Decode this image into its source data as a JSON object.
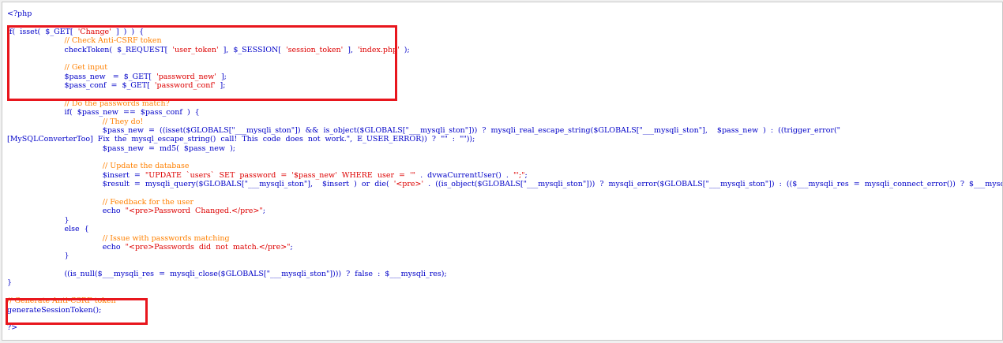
{
  "colors": {
    "keyword": "#0000C8",
    "comment": "#FF8000",
    "string": "#DD0000",
    "highlight": "#E8161D",
    "background": "#FFFFFF"
  },
  "code": {
    "lines": [
      {
        "segments": [
          {
            "text": "<?php",
            "style": "blue"
          }
        ]
      },
      {
        "segments": [
          {
            "text": "",
            "style": "blue"
          }
        ]
      },
      {
        "segments": [
          {
            "text": "if(  isset(  $_GET[  ",
            "style": "blue"
          },
          {
            "text": "'Change'",
            "style": "red"
          },
          {
            "text": "  ]  )  )  {",
            "style": "blue"
          }
        ]
      },
      {
        "segments": [
          {
            "text": "                        // Check Anti-CSRF token",
            "style": "orange"
          }
        ]
      },
      {
        "segments": [
          {
            "text": "                        checkToken(  $_REQUEST[  ",
            "style": "blue"
          },
          {
            "text": "'user_token'",
            "style": "red"
          },
          {
            "text": "  ],  $_SESSION[  ",
            "style": "blue"
          },
          {
            "text": "'session_token'",
            "style": "red"
          },
          {
            "text": "  ],  ",
            "style": "blue"
          },
          {
            "text": "'index.php'",
            "style": "red"
          },
          {
            "text": "  );",
            "style": "blue"
          }
        ]
      },
      {
        "segments": [
          {
            "text": "",
            "style": "blue"
          }
        ]
      },
      {
        "segments": [
          {
            "text": "                        // Get input",
            "style": "orange"
          }
        ]
      },
      {
        "segments": [
          {
            "text": "                        $pass_new   =  $_GET[  ",
            "style": "blue"
          },
          {
            "text": "'password_new'",
            "style": "red"
          },
          {
            "text": "  ];",
            "style": "blue"
          }
        ]
      },
      {
        "segments": [
          {
            "text": "                        $pass_conf  =  $_GET[  ",
            "style": "blue"
          },
          {
            "text": "'password_conf'",
            "style": "red"
          },
          {
            "text": "  ];",
            "style": "blue"
          }
        ]
      },
      {
        "segments": [
          {
            "text": "",
            "style": "blue"
          }
        ]
      },
      {
        "segments": [
          {
            "text": "                        // Do the passwords match?",
            "style": "orange"
          }
        ]
      },
      {
        "segments": [
          {
            "text": "                        if(  $pass_new  ==  $pass_conf  )  {",
            "style": "blue"
          }
        ]
      },
      {
        "segments": [
          {
            "text": "                                        // They do!",
            "style": "orange"
          }
        ]
      },
      {
        "segments": [
          {
            "text": "                                        $pass_new  =  ((isset($GLOBALS[\"___mysqli_ston\"])  &&  is_object($GLOBALS[\"___mysqli_ston\"]))  ?  mysqli_real_escape_string($GLOBALS[\"___mysqli_ston\"],    $pass_new  )  :  ((trigger_error(\"",
            "style": "blue"
          }
        ]
      },
      {
        "segments": [
          {
            "text": "[MySQLConverterToo]  Fix  the  mysql_escape_string()  call!  This  code  does  not  work.\",  E_USER_ERROR))  ?  \"\"  :  \"\"));",
            "style": "blue"
          }
        ]
      },
      {
        "segments": [
          {
            "text": "                                        $pass_new  =  md5(  $pass_new  );",
            "style": "blue"
          }
        ]
      },
      {
        "segments": [
          {
            "text": "",
            "style": "blue"
          }
        ]
      },
      {
        "segments": [
          {
            "text": "                                        // Update the database",
            "style": "orange"
          }
        ]
      },
      {
        "segments": [
          {
            "text": "                                        $insert  =  ",
            "style": "blue"
          },
          {
            "text": "\"UPDATE  `users`  SET  password  =  '$pass_new'  WHERE  user  =  '\"",
            "style": "red"
          },
          {
            "text": "  .  dvwaCurrentUser()  .  ",
            "style": "blue"
          },
          {
            "text": "\"';\"",
            "style": "red"
          },
          {
            "text": ";",
            "style": "blue"
          }
        ]
      },
      {
        "segments": [
          {
            "text": "                                        $result  =  mysqli_query($GLOBALS[\"___mysqli_ston\"],    $insert  )  or  die(  ",
            "style": "blue"
          },
          {
            "text": "'<pre>'",
            "style": "red"
          },
          {
            "text": "  .  ((is_object($GLOBALS[\"___mysqli_ston\"]))  ?  mysqli_error($GLOBALS[\"___mysqli_ston\"])  :  (($___mysqli_res  =  mysqli_connect_error())  ?  $___mysqli_res",
            "style": "blue"
          }
        ]
      },
      {
        "segments": [
          {
            "text": "",
            "style": "blue"
          }
        ]
      },
      {
        "segments": [
          {
            "text": "                                        // Feedback for the user",
            "style": "orange"
          }
        ]
      },
      {
        "segments": [
          {
            "text": "                                        echo  ",
            "style": "blue"
          },
          {
            "text": "\"<pre>Password  Changed.</pre>\"",
            "style": "red"
          },
          {
            "text": ";",
            "style": "blue"
          }
        ]
      },
      {
        "segments": [
          {
            "text": "                        }",
            "style": "blue"
          }
        ]
      },
      {
        "segments": [
          {
            "text": "                        else  {",
            "style": "blue"
          }
        ]
      },
      {
        "segments": [
          {
            "text": "                                        // Issue with passwords matching",
            "style": "orange"
          }
        ]
      },
      {
        "segments": [
          {
            "text": "                                        echo  ",
            "style": "blue"
          },
          {
            "text": "\"<pre>Passwords  did  not  match.</pre>\"",
            "style": "red"
          },
          {
            "text": ";",
            "style": "blue"
          }
        ]
      },
      {
        "segments": [
          {
            "text": "                        }",
            "style": "blue"
          }
        ]
      },
      {
        "segments": [
          {
            "text": "",
            "style": "blue"
          }
        ]
      },
      {
        "segments": [
          {
            "text": "                        ((is_null($___mysqli_res  =  mysqli_close($GLOBALS[\"___mysqli_ston\"])))  ?  false  :  $___mysqli_res);",
            "style": "blue"
          }
        ]
      },
      {
        "segments": [
          {
            "text": "}",
            "style": "blue"
          }
        ]
      },
      {
        "segments": [
          {
            "text": "",
            "style": "blue"
          }
        ]
      },
      {
        "segments": [
          {
            "text": "// Generate Anti-CSRF token",
            "style": "orange"
          }
        ]
      },
      {
        "segments": [
          {
            "text": "generateSessionToken();",
            "style": "blue"
          }
        ]
      },
      {
        "segments": [
          {
            "text": "",
            "style": "blue"
          }
        ]
      },
      {
        "segments": [
          {
            "text": "?>",
            "style": "blue"
          }
        ]
      }
    ]
  }
}
